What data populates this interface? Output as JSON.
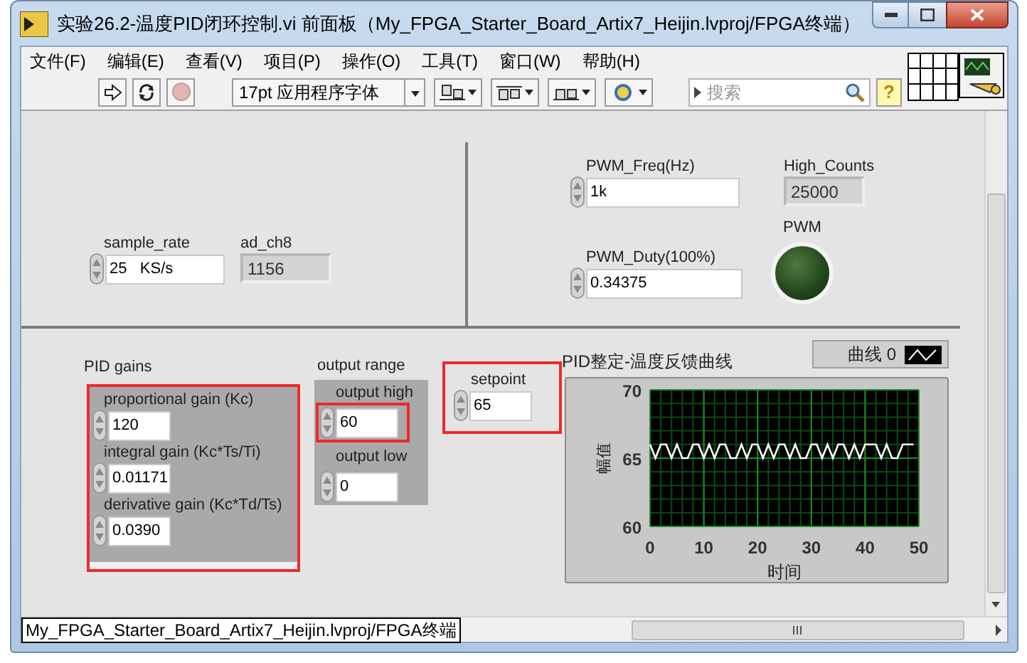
{
  "window": {
    "title": "实验26.2-温度PID闭环控制.vi 前面板（My_FPGA_Starter_Board_Artix7_Heijin.lvproj/FPGA终端）"
  },
  "menu": [
    "文件(F)",
    "编辑(E)",
    "查看(V)",
    "项目(P)",
    "操作(O)",
    "工具(T)",
    "窗口(W)",
    "帮助(H)"
  ],
  "toolbar": {
    "abort": {
      "disabled": true
    },
    "font": "17pt 应用程序字体",
    "search": {
      "placeholder": "搜索"
    },
    "help": "?"
  },
  "sample_rate": {
    "label": "sample_rate",
    "value": "25   KS/s"
  },
  "ad_ch8": {
    "label": "ad_ch8",
    "value": "1156"
  },
  "pwm_freq": {
    "label": "PWM_Freq(Hz)",
    "value": "1k"
  },
  "high_counts": {
    "label": "High_Counts",
    "value": "25000"
  },
  "pwm_duty": {
    "label": "PWM_Duty(100%)",
    "value": "0.34375"
  },
  "pwm_led": {
    "label": "PWM",
    "on": false
  },
  "pid_gains": {
    "label": "PID gains",
    "highlighted": true,
    "items": [
      {
        "label": "proportional gain (Kc)",
        "value": "120"
      },
      {
        "label": "integral gain (Kc*Ts/Ti)",
        "value": "0.01171"
      },
      {
        "label": "derivative gain (Kc*Td/Ts)",
        "value": "0.0390"
      }
    ]
  },
  "output_range": {
    "label": "output range",
    "items": [
      {
        "label": "output high",
        "value": "60",
        "highlighted": true
      },
      {
        "label": "output low",
        "value": "0",
        "highlighted": false
      }
    ]
  },
  "setpoint": {
    "label": "setpoint",
    "value": "65",
    "highlighted": true
  },
  "chart": {
    "chart_data": {
      "type": "line",
      "title": "PID整定-温度反馈曲线",
      "xlabel": "时间",
      "ylabel": "幅值",
      "x": [
        0,
        1,
        2,
        3,
        4,
        5,
        6,
        7,
        8,
        9,
        10,
        11,
        12,
        13,
        14,
        15,
        16,
        17,
        18,
        19,
        20,
        21,
        22,
        23,
        24,
        25,
        26,
        27,
        28,
        29,
        30,
        31,
        32,
        33,
        34,
        35,
        36,
        37,
        38,
        39,
        40,
        41,
        42,
        43,
        44,
        45,
        46,
        47,
        48,
        49
      ],
      "series": [
        {
          "name": "曲线 0",
          "color": "#ffffff",
          "values": [
            66,
            65,
            66,
            66,
            65,
            66,
            65,
            65,
            66,
            66,
            65,
            66,
            65,
            66,
            66,
            65,
            65,
            66,
            65,
            66,
            66,
            65,
            66,
            65,
            66,
            66,
            65,
            66,
            65,
            65,
            66,
            66,
            65,
            66,
            65,
            66,
            66,
            65,
            66,
            65,
            66,
            66,
            66,
            65,
            66,
            65,
            65,
            66,
            66,
            66
          ]
        }
      ],
      "xlim": [
        0,
        50
      ],
      "ylim": [
        60,
        70
      ],
      "xticks": [
        0,
        10,
        20,
        30,
        40,
        50
      ],
      "yticks": [
        60,
        65,
        70
      ],
      "grid": true
    }
  },
  "status_path": "My_FPGA_Starter_Board_Artix7_Heijin.lvproj/FPGA终端"
}
